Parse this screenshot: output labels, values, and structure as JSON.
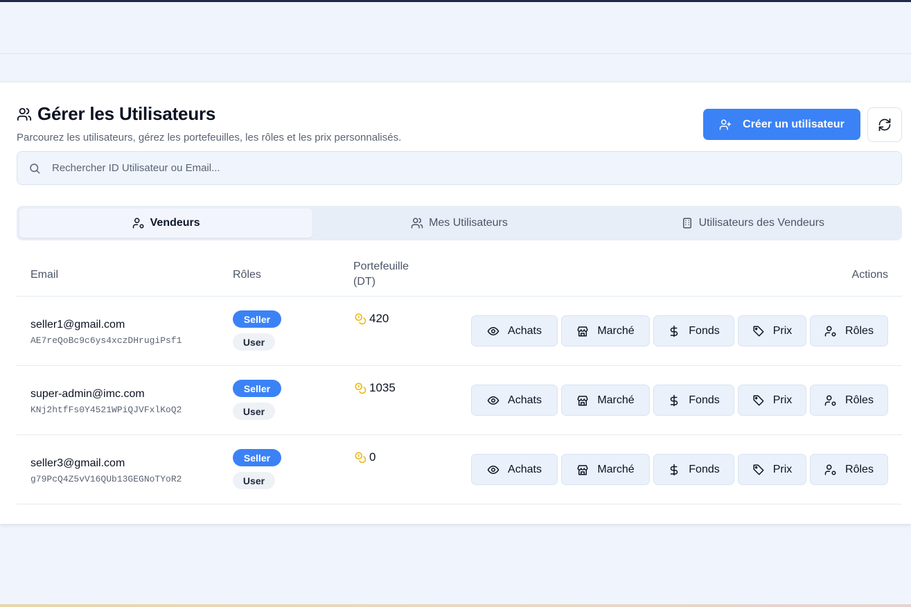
{
  "header": {
    "title": "Gérer les Utilisateurs",
    "subtitle": "Parcourez les utilisateurs, gérez les portefeuilles, les rôles et les prix personnalisés.",
    "create_label": "Créer un utilisateur"
  },
  "search": {
    "placeholder": "Rechercher ID Utilisateur ou Email..."
  },
  "tabs": [
    {
      "label": "Vendeurs",
      "active": true
    },
    {
      "label": "Mes Utilisateurs",
      "active": false
    },
    {
      "label": "Utilisateurs des Vendeurs",
      "active": false
    }
  ],
  "table": {
    "columns": {
      "email": "Email",
      "roles": "Rôles",
      "wallet_line1": "Portefeuille",
      "wallet_line2": "(DT)",
      "actions": "Actions"
    },
    "rows": [
      {
        "email": "seller1@gmail.com",
        "uid": "AE7reQoBc9c6ys4xczDHrugiPsf1",
        "roles": [
          "Seller",
          "User"
        ],
        "wallet": "420"
      },
      {
        "email": "super-admin@imc.com",
        "uid": "KNj2htfFs0Y4521WPiQJVFxlKoQ2",
        "roles": [
          "Seller",
          "User"
        ],
        "wallet": "1035"
      },
      {
        "email": "seller3@gmail.com",
        "uid": "g79PcQ4Z5vV16QUb13GEGNoTYoR2",
        "roles": [
          "Seller",
          "User"
        ],
        "wallet": "0"
      }
    ],
    "actions": {
      "achats": "Achats",
      "marche": "Marché",
      "fonds": "Fonds",
      "prix": "Prix",
      "roles": "Rôles"
    }
  },
  "colors": {
    "primary": "#3b82f6",
    "coin": "#eab308",
    "background": "#f0f5fd"
  },
  "icons": [
    "users-icon",
    "user-plus-icon",
    "refresh-icon",
    "search-icon",
    "user-cog-icon",
    "building-icon",
    "coins-icon",
    "eye-icon",
    "store-icon",
    "dollar-icon",
    "tag-icon"
  ]
}
